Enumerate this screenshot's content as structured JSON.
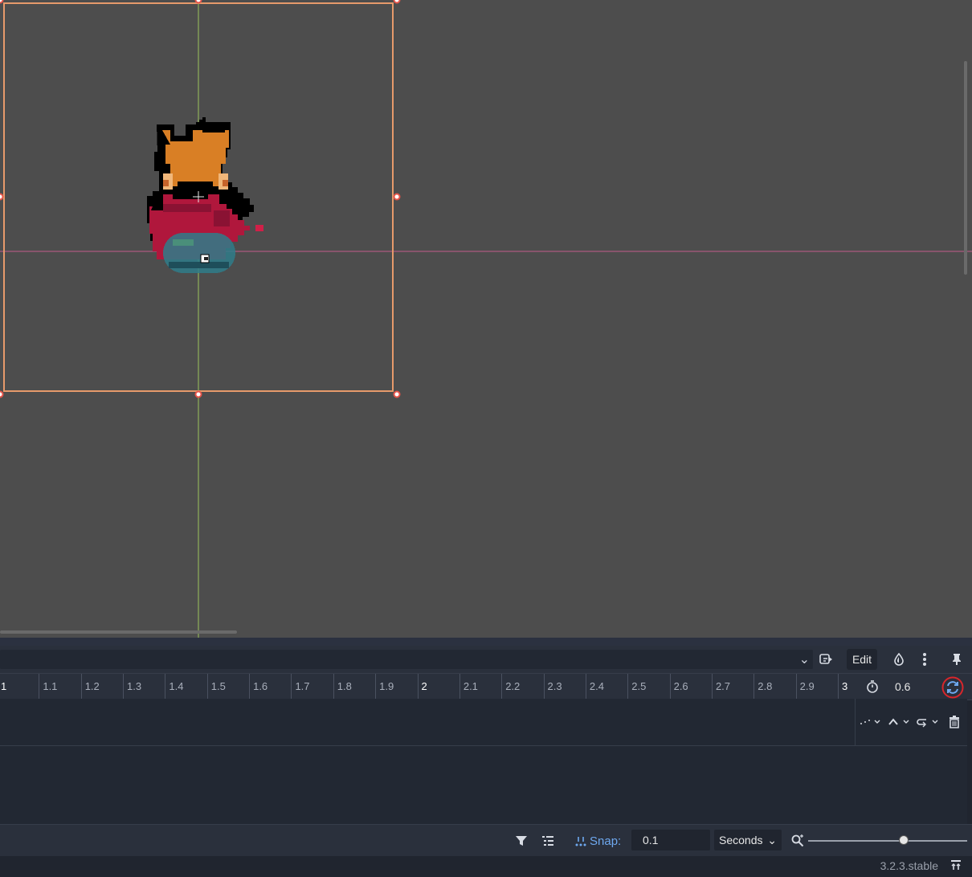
{
  "colors": {
    "viewport_bg": "#4d4d4d",
    "selection_rect": "#e69a6b",
    "y_axis": "#9bc45a",
    "x_axis": "#c45a8c",
    "panel_bg": "#20252f",
    "toolbar_bg": "#2a303c",
    "accent": "#6ea8ef",
    "loop_highlight": "#d9262b"
  },
  "animation_toolbar": {
    "animation_select": "",
    "edit_label": "Edit",
    "icons": [
      "animation-options-icon",
      "onion-skin-icon",
      "more-options-icon",
      "pin-icon"
    ]
  },
  "timeline": {
    "ticks": [
      "1",
      "1.1",
      "1.2",
      "1.3",
      "1.4",
      "1.5",
      "1.6",
      "1.7",
      "1.8",
      "1.9",
      "2",
      "2.1",
      "2.2",
      "2.3",
      "2.4",
      "2.5",
      "2.6",
      "2.7",
      "2.8",
      "2.9",
      "3"
    ],
    "major_ticks": [
      "1",
      "2",
      "3"
    ],
    "length_value": "0.6",
    "loop_enabled": true
  },
  "track_tools": {
    "icons": [
      "interpolation-icon",
      "update-mode-icon",
      "loop-wrap-icon",
      "delete-track-icon"
    ]
  },
  "bottom_bar": {
    "snap_label": "Snap:",
    "snap_value": "0.1",
    "unit_select": "Seconds",
    "zoom_level": 0.6
  },
  "status": {
    "version": "3.2.3.stable"
  }
}
